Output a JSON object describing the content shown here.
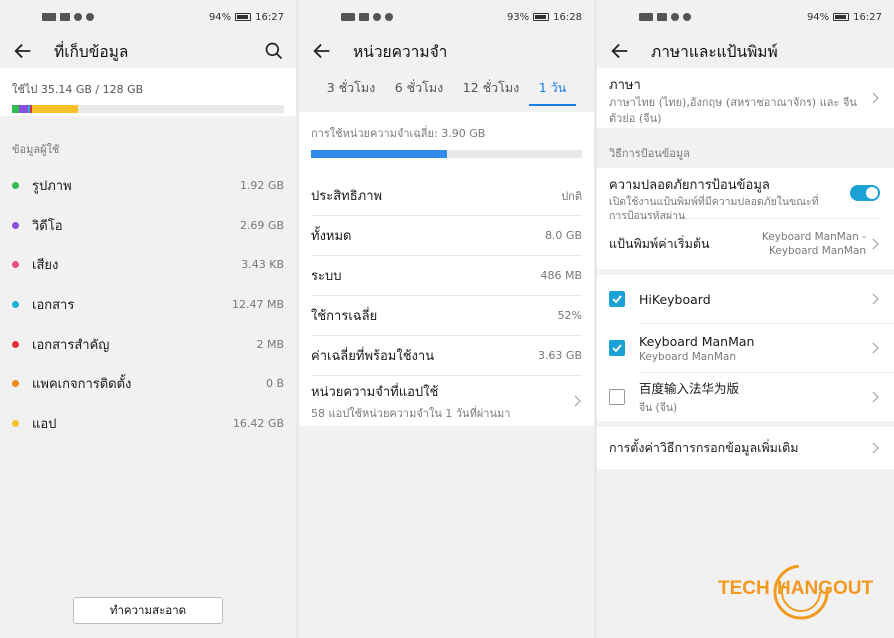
{
  "status_left": {
    "p1_time": "16:27",
    "p1_batt": "94%",
    "p2_time": "16:28",
    "p2_batt": "93%",
    "p3_time": "16:27",
    "p3_batt": "94%"
  },
  "storage": {
    "title": "ที่เก็บข้อมูล",
    "used_text": "ใช้ไป 35.14 GB / 128 GB",
    "section_label": "ข้อมูลผู้ใช้",
    "categories": [
      {
        "label": "รูปภาพ",
        "size": "1.92 GB",
        "color": "#2ebd4e"
      },
      {
        "label": "วิดีโอ",
        "size": "2.69 GB",
        "color": "#8a4fdf"
      },
      {
        "label": "เสียง",
        "size": "3.43 KB",
        "color": "#e8517b"
      },
      {
        "label": "เอกสาร",
        "size": "12.47 MB",
        "color": "#1cb1d8"
      },
      {
        "label": "เอกสารสำคัญ",
        "size": "2 MB",
        "color": "#e53238"
      },
      {
        "label": "แพคเกจการติดตั้ง",
        "size": "0 B",
        "color": "#f28b18"
      },
      {
        "label": "แอป",
        "size": "16.42 GB",
        "color": "#f8c12a"
      }
    ],
    "clean_button": "ทำความสะอาด"
  },
  "memory": {
    "title": "หน่วยความจำ",
    "tabs": [
      "3 ชั่วโมง",
      "6 ชั่วโมง",
      "12 ชั่วโมง",
      "1 วัน"
    ],
    "avg_usage": "การใช้หน่วยความจำเฉลี่ย: 3.90 GB",
    "avg_fraction": 0.5,
    "rows": [
      {
        "label": "ประสิทธิภาพ",
        "value": "ปกติ"
      },
      {
        "label": "ทั้งหมด",
        "value": "8.0 GB"
      },
      {
        "label": "ระบบ",
        "value": "486 MB"
      },
      {
        "label": "ใช้การเฉลี่ย",
        "value": "52%"
      },
      {
        "label": "ค่าเฉลี่ยที่พร้อมใช้งาน",
        "value": "3.63 GB"
      }
    ],
    "apps_title": "หน่วยความจำที่แอปใช้",
    "apps_sub": "58 แอปใช้หน่วยความจำใน 1 วันที่ผ่านมา"
  },
  "language": {
    "title": "ภาษาและแป้นพิมพ์",
    "lang_title": "ภาษา",
    "lang_sub": "ภาษาไทย (ไทย),อังกฤษ (สหราชอาณาจักร) และ จีนตัวย่อ (จีน)",
    "input_section": "วิธีการป้อนข้อมูล",
    "secure_title": "ความปลอดภัยการป้อนข้อมูล",
    "secure_sub": "เปิดใช้งานแป้นพิมพ์ที่มีความปลอดภัยในขณะที่การป้อนรหัสผ่าน",
    "default_kb_label": "แป้นพิมพ์ค่าเริ่มต้น",
    "default_kb_value": "Keyboard ManMan - Keyboard ManMan",
    "keyboards": [
      {
        "name": "HiKeyboard",
        "sub": "",
        "checked": true
      },
      {
        "name": "Keyboard ManMan",
        "sub": "Keyboard ManMan",
        "checked": true
      },
      {
        "name": "百度输入法华为版",
        "sub": "จีน (จีน)",
        "checked": false
      }
    ],
    "more_settings": "การตั้งค่าวิธีการกรอกข้อมูลเพิ่มเติม"
  },
  "watermark": {
    "text_a": "TECH",
    "text_b": "HANGOUT"
  }
}
